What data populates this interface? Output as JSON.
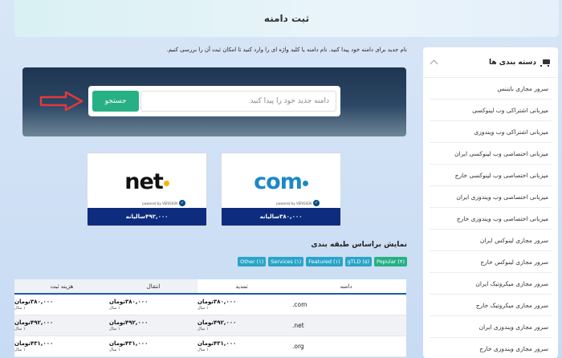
{
  "header": {
    "title": "ثبت دامنه"
  },
  "sidebar": {
    "title": "دسته بندی ها",
    "items": [
      "سرور مجازی بایننس",
      "میزبانی اشتراکی وب لینوکسی",
      "میزبانی اشتراکی وب ویندوزی",
      "میزبانی اختصاصی وب لینوکسی ایران",
      "میزبانی اختصاصی وب لینوکسی خارج",
      "میزبانی اختصاصی وب ویندوزی ایران",
      "میزبانی اختصاصی وب ویندوزی خارج",
      "سرور مجازی لینوکس ایران",
      "سرور مجازی لینوکس خارج",
      "سرور مجازی میکروتیک ایران",
      "سرور مجازی میکروتیک خارج",
      "سرور مجازی ویندوزی ایران",
      "سرور مجازی ویندوزی خارج"
    ]
  },
  "intro": "نام جدید برای دامنه خود پیدا کنید. نام دامنه یا کلید واژه ای را وارد کنید تا امکان ثبت آن را بررسی کنیم.",
  "search": {
    "placeholder": "دامنه جدید خود را پیدا کنید",
    "button": "جستجو"
  },
  "cards": [
    {
      "tld": "com",
      "powered": "powered by VERISIGN",
      "price": "۳۸۰,۰۰۰سالیانه",
      "color": "#1c88c7"
    },
    {
      "tld": "net",
      "powered": "powered by VERISIGN",
      "price": "۴۹۲,۰۰۰سالیانه",
      "color": "#f2b705"
    }
  ],
  "filter": {
    "title": "نمایش براساس طبقه بندی",
    "pills": [
      "Popular (۴)",
      "gTLD (۵)",
      "Featured (۱)",
      "Services (۱)",
      "Other (۱)"
    ]
  },
  "table": {
    "headers": {
      "domain": "دامنه",
      "renew": "تمدید",
      "transfer": "انتقال",
      "register": "هزینه ثبت"
    },
    "rows": [
      {
        "tld": ".com",
        "renew": "۳۸۰,۰۰۰تومان",
        "transfer": "۳۸۰,۰۰۰تومان",
        "register": "۳۸۰,۰۰۰تومان",
        "unit": "۱ سال"
      },
      {
        "tld": ".net",
        "renew": "۴۹۲,۰۰۰تومان",
        "transfer": "۴۹۲,۰۰۰تومان",
        "register": "۴۹۲,۰۰۰تومان",
        "unit": "۱ سال"
      },
      {
        "tld": ".org",
        "renew": "۴۳۱,۰۰۰تومان",
        "transfer": "۴۳۱,۰۰۰تومان",
        "register": "۴۳۱,۰۰۰تومان",
        "unit": "۱ سال"
      }
    ]
  }
}
